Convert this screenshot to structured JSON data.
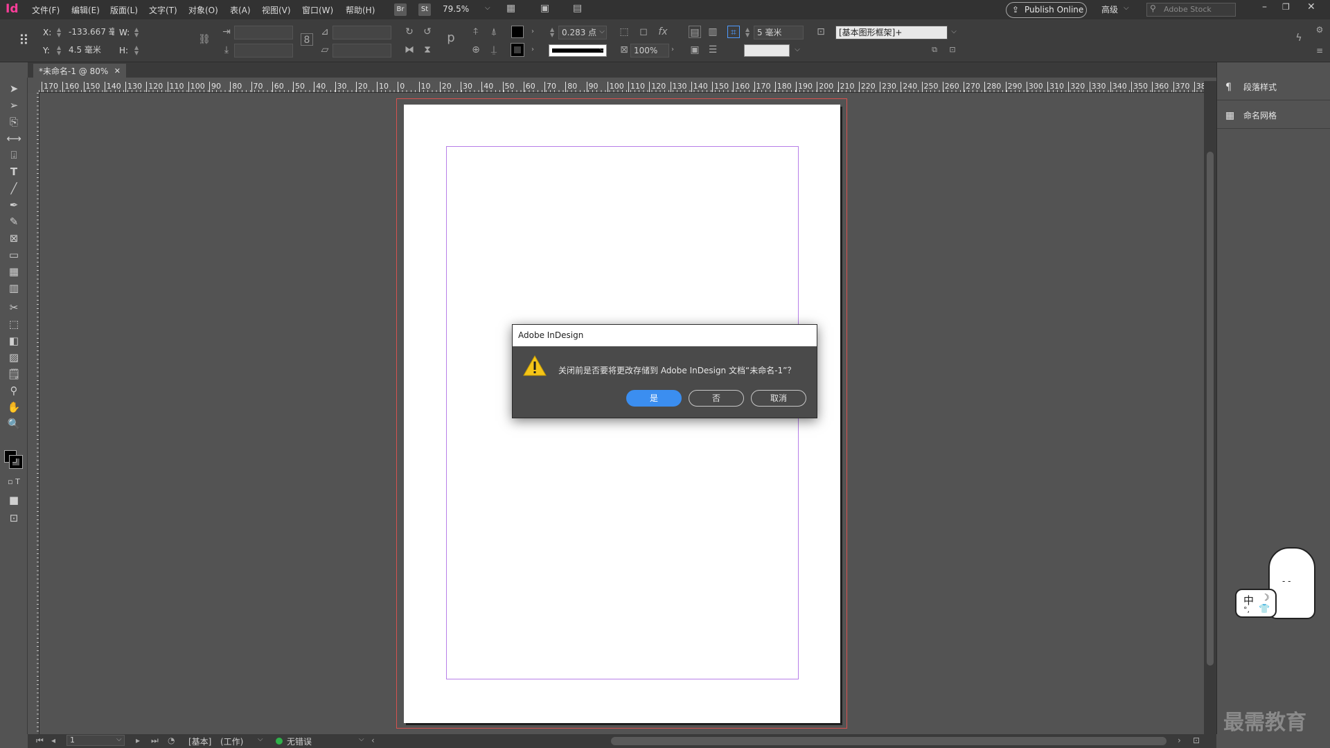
{
  "app": {
    "logo_text": "Id"
  },
  "menu": [
    "文件(F)",
    "编辑(E)",
    "版面(L)",
    "文字(T)",
    "对象(O)",
    "表(A)",
    "视图(V)",
    "窗口(W)",
    "帮助(H)"
  ],
  "topbar": {
    "bridge": "Br",
    "stock": "St",
    "zoom": "79.5%",
    "publish_online": "Publish Online",
    "workspace": "高级",
    "search_placeholder": "Adobe Stock"
  },
  "control": {
    "x_label": "X:",
    "x_value": "-133.667 毫",
    "y_label": "Y:",
    "y_value": "4.5 毫米",
    "w_label": "W:",
    "h_label": "H:",
    "stroke_weight": "0.283 点",
    "opacity": "100%",
    "offset": "5 毫米",
    "object_style": "[基本图形框架]+"
  },
  "document": {
    "tab_label": "*未命名-1 @ 80%"
  },
  "ruler": {
    "h_labels": [
      "170",
      "160",
      "150",
      "140",
      "130",
      "120",
      "110",
      "100",
      "90",
      "80",
      "70",
      "60",
      "50",
      "40",
      "30",
      "20",
      "10",
      "0",
      "10",
      "20",
      "30",
      "40",
      "50",
      "60",
      "70",
      "80",
      "90",
      "100",
      "110",
      "120",
      "130",
      "140",
      "150",
      "160",
      "170",
      "180",
      "190",
      "200",
      "210",
      "220",
      "230",
      "240",
      "250",
      "260",
      "270",
      "280",
      "290",
      "300",
      "310",
      "320",
      "330",
      "340",
      "350",
      "360",
      "370",
      "38"
    ]
  },
  "panels": {
    "paragraph_styles": "段落样式",
    "named_grids": "命名网格"
  },
  "status": {
    "page": "1",
    "master": "[基本]",
    "mode": "(工作)",
    "preflight": "无错误"
  },
  "dialog": {
    "title": "Adobe InDesign",
    "message": "关闭前是否要将更改存储到 Adobe InDesign 文档“未命名-1”？",
    "yes": "是",
    "no": "否",
    "cancel": "取消"
  },
  "overlay": {
    "ime": "中",
    "watermark": "最需教育"
  },
  "colors": {
    "accent": "#3b8ef0",
    "bleed": "#d8524f",
    "margin": "#b77ee8",
    "logo": "#ff3d9a",
    "ok": "#2fb24a"
  }
}
